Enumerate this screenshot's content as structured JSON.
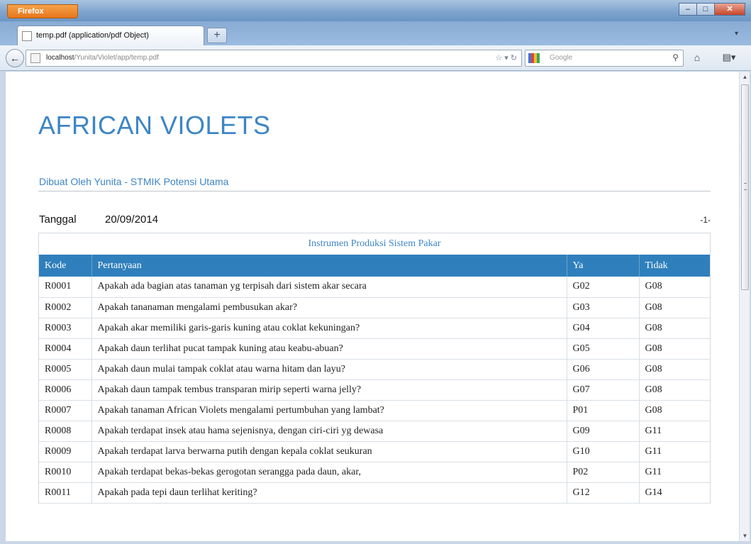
{
  "browser": {
    "app_button": "Firefox",
    "tab_title": "temp.pdf (application/pdf Object)",
    "url_host": "localhost",
    "url_path": "/Yunita/Violet/app/temp.pdf",
    "search_placeholder": "Google",
    "window_controls": [
      "minimize-icon",
      "maximize-icon",
      "close-icon"
    ]
  },
  "document": {
    "title": "AFRICAN VIOLETS",
    "subtitle": "Dibuat Oleh Yunita - STMIK Potensi Utama",
    "date_label": "Tanggal",
    "date_value": "20/09/2014",
    "page_number": "-1-",
    "table": {
      "caption": "Instrumen Produksi Sistem Pakar",
      "headers": [
        "Kode",
        "Pertanyaan",
        "Ya",
        "Tidak"
      ],
      "rows": [
        [
          "R0001",
          "Apakah ada bagian atas tanaman yg terpisah dari sistem akar secara",
          "G02",
          "G08"
        ],
        [
          "R0002",
          "Apakah tananaman mengalami pembusukan akar?",
          "G03",
          "G08"
        ],
        [
          "R0003",
          "Apakah akar memiliki garis-garis kuning atau coklat kekuningan?",
          "G04",
          "G08"
        ],
        [
          "R0004",
          "Apakah daun terlihat pucat  tampak kuning atau keabu-abuan?",
          "G05",
          "G08"
        ],
        [
          "R0005",
          "Apakah daun mulai tampak coklat atau warna hitam dan layu?",
          "G06",
          "G08"
        ],
        [
          "R0006",
          "Apakah daun tampak tembus transparan mirip seperti warna jelly?",
          "G07",
          "G08"
        ],
        [
          "R0007",
          "Apakah tanaman African Violets mengalami pertumbuhan yang lambat?",
          "P01",
          "G08"
        ],
        [
          "R0008",
          "Apakah terdapat insek atau hama sejenisnya, dengan ciri-ciri yg dewasa",
          "G09",
          "G11"
        ],
        [
          "R0009",
          "Apakah terdapat larva berwarna putih dengan kepala coklat seukuran",
          "G10",
          "G11"
        ],
        [
          "R0010",
          "Apakah terdapat bekas-bekas gerogotan serangga pada daun, akar,",
          "P02",
          "G11"
        ],
        [
          "R0011",
          "Apakah pada tepi daun terlihat keriting?",
          "G12",
          "G14"
        ]
      ]
    }
  },
  "colors": {
    "accent": "#3d86c6",
    "table_header_bg": "#2f7fbc"
  }
}
